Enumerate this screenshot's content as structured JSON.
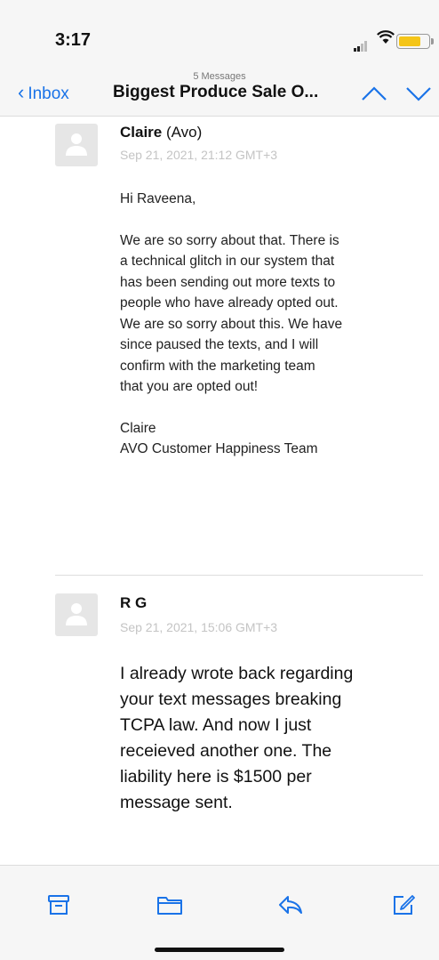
{
  "status_bar": {
    "time": "3:17"
  },
  "nav": {
    "back_label": "Inbox",
    "message_count": "5 Messages",
    "title": "Biggest Produce Sale O..."
  },
  "messages": [
    {
      "sender_name": "Claire",
      "sender_tag": "(Avo)",
      "date": "Sep 21, 2021, 21:12 GMT+3",
      "greeting": "Hi Raveena,",
      "lines": [
        "We are so sorry about that. There is",
        "a technical glitch in our system that",
        "has been sending out more texts to",
        "people who have already opted out.",
        "We are so sorry about this. We have",
        "since paused the texts, and I will",
        "confirm with the marketing team",
        "that you are opted out!"
      ],
      "signature_name": "Claire",
      "signature_team": "AVO Customer Happiness Team"
    },
    {
      "sender_name": "R G",
      "date": "Sep 21, 2021, 15:06 GMT+3",
      "lines": [
        "I already wrote back regarding",
        "your text messages breaking",
        "TCPA law. And now I just",
        "receieved another one. The",
        "liability here is $1500 per",
        "message sent."
      ]
    }
  ],
  "toolbar": {
    "icons": [
      "archive-icon",
      "folder-icon",
      "reply-icon",
      "compose-icon"
    ]
  },
  "colors": {
    "accent": "#1a73e8",
    "date_gray": "#c4c4c4",
    "bar_bg": "#f6f6f6"
  }
}
